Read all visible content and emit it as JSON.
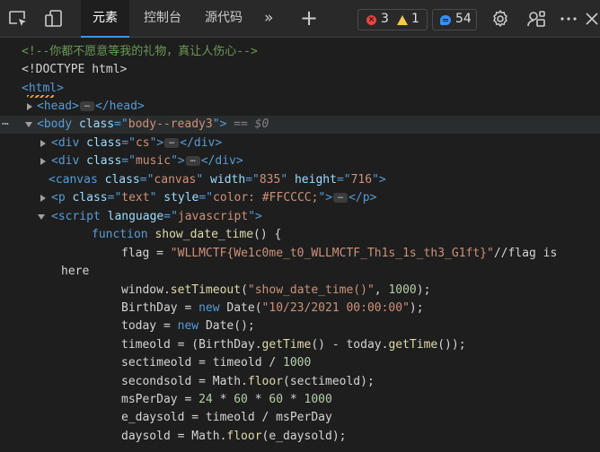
{
  "toolbar": {
    "tabs": [
      {
        "label": "元素",
        "active": true
      },
      {
        "label": "控制台",
        "active": false
      },
      {
        "label": "源代码",
        "active": false
      }
    ],
    "more_tabs": "»",
    "add_tab": "+",
    "errors": "3",
    "warnings": "1",
    "messages": "54",
    "icons": [
      "inspect-element-icon",
      "device-emulation-icon",
      "settings-gear-icon",
      "connected-devices-icon",
      "more-options-icon",
      "close-icon"
    ]
  },
  "lines": [
    {
      "segs": [
        {
          "t": "<!--你都不愿意等我的礼物，真让人伤心-->",
          "c": "comment"
        }
      ]
    },
    {
      "segs": [
        {
          "t": "<!DOCTYPE html>",
          "c": "text"
        }
      ]
    },
    {
      "segs": [
        {
          "t": "<html>",
          "c": "tag"
        }
      ]
    },
    {
      "segs": [
        {
          "t": "<head>",
          "c": "tag"
        },
        {
          "t": "…",
          "c": "ellipsis"
        },
        {
          "t": "</head>",
          "c": "tag"
        }
      ]
    },
    {
      "segs": [
        {
          "t": "<body ",
          "c": "tag"
        },
        {
          "t": "class",
          "c": "attr"
        },
        {
          "t": "=\"",
          "c": "tag"
        },
        {
          "t": "body--ready3",
          "c": "val"
        },
        {
          "t": "\">",
          "c": "tag"
        },
        {
          "t": " == $0",
          "c": "muted"
        }
      ]
    },
    {
      "segs": [
        {
          "t": "<div ",
          "c": "tag"
        },
        {
          "t": "class",
          "c": "attr"
        },
        {
          "t": "=\"",
          "c": "tag"
        },
        {
          "t": "cs",
          "c": "val"
        },
        {
          "t": "\">",
          "c": "tag"
        },
        {
          "t": "…",
          "c": "ellipsis"
        },
        {
          "t": "</div>",
          "c": "tag"
        }
      ]
    },
    {
      "segs": [
        {
          "t": "<div ",
          "c": "tag"
        },
        {
          "t": "class",
          "c": "attr"
        },
        {
          "t": "=\"",
          "c": "tag"
        },
        {
          "t": "music",
          "c": "val"
        },
        {
          "t": "\">",
          "c": "tag"
        },
        {
          "t": "…",
          "c": "ellipsis"
        },
        {
          "t": "</div>",
          "c": "tag"
        }
      ]
    },
    {
      "segs": [
        {
          "t": "<canvas ",
          "c": "tag"
        },
        {
          "t": "class",
          "c": "attr"
        },
        {
          "t": "=\"",
          "c": "tag"
        },
        {
          "t": "canvas",
          "c": "val"
        },
        {
          "t": "\" ",
          "c": "tag"
        },
        {
          "t": "width",
          "c": "attr"
        },
        {
          "t": "=\"",
          "c": "tag"
        },
        {
          "t": "835",
          "c": "val"
        },
        {
          "t": "\" ",
          "c": "tag"
        },
        {
          "t": "height",
          "c": "attr"
        },
        {
          "t": "=\"",
          "c": "tag"
        },
        {
          "t": "716",
          "c": "val"
        },
        {
          "t": "\">",
          "c": "tag"
        }
      ]
    },
    {
      "segs": [
        {
          "t": "<p ",
          "c": "tag"
        },
        {
          "t": "class",
          "c": "attr"
        },
        {
          "t": "=\"",
          "c": "tag"
        },
        {
          "t": "text",
          "c": "val"
        },
        {
          "t": "\" ",
          "c": "tag"
        },
        {
          "t": "style",
          "c": "attr"
        },
        {
          "t": "=\"",
          "c": "tag"
        },
        {
          "t": "color: #FFCCCC;",
          "c": "val"
        },
        {
          "t": "\">",
          "c": "tag"
        },
        {
          "t": "…",
          "c": "ellipsis"
        },
        {
          "t": "</p>",
          "c": "tag"
        }
      ]
    },
    {
      "segs": [
        {
          "t": "<script ",
          "c": "tag"
        },
        {
          "t": "language",
          "c": "attr"
        },
        {
          "t": "=\"",
          "c": "tag"
        },
        {
          "t": "javascript",
          "c": "val"
        },
        {
          "t": "\">",
          "c": "tag"
        }
      ]
    },
    {
      "segs": [
        {
          "t": "function ",
          "c": "kw"
        },
        {
          "t": "show_date_time",
          "c": "fnname"
        },
        {
          "t": "() {",
          "c": "plain"
        }
      ]
    },
    {
      "segs": [
        {
          "t": "flag = ",
          "c": "plain"
        },
        {
          "t": "\"WLLMCTF{We1c0me_t0_WLLMCTF_Th1s_1s_th3_G1ft}\"",
          "c": "val"
        },
        {
          "t": "//flag is",
          "c": "plain"
        }
      ]
    },
    {
      "segs": [
        {
          "t": "here",
          "c": "plain"
        }
      ]
    },
    {
      "segs": [
        {
          "t": "window.",
          "c": "plain"
        },
        {
          "t": "setTimeout",
          "c": "fn"
        },
        {
          "t": "(",
          "c": "plain"
        },
        {
          "t": "\"show_date_time()\"",
          "c": "val"
        },
        {
          "t": ", ",
          "c": "plain"
        },
        {
          "t": "1000",
          "c": "num"
        },
        {
          "t": ");",
          "c": "plain"
        }
      ]
    },
    {
      "segs": [
        {
          "t": "BirthDay = ",
          "c": "plain"
        },
        {
          "t": "new ",
          "c": "kw"
        },
        {
          "t": "Date(",
          "c": "plain"
        },
        {
          "t": "\"10/23/2021 00:00:00\"",
          "c": "val"
        },
        {
          "t": ");",
          "c": "plain"
        }
      ]
    },
    {
      "segs": [
        {
          "t": "today = ",
          "c": "plain"
        },
        {
          "t": "new ",
          "c": "kw"
        },
        {
          "t": "Date();",
          "c": "plain"
        }
      ]
    },
    {
      "segs": [
        {
          "t": "timeold = (BirthDay.",
          "c": "plain"
        },
        {
          "t": "getTime",
          "c": "fn"
        },
        {
          "t": "() - today.",
          "c": "plain"
        },
        {
          "t": "getTime",
          "c": "fn"
        },
        {
          "t": "());",
          "c": "plain"
        }
      ]
    },
    {
      "segs": [
        {
          "t": "sectimeold = timeold / ",
          "c": "plain"
        },
        {
          "t": "1000",
          "c": "num"
        }
      ]
    },
    {
      "segs": [
        {
          "t": "secondsold = Math.",
          "c": "plain"
        },
        {
          "t": "floor",
          "c": "fn"
        },
        {
          "t": "(sectimeold);",
          "c": "plain"
        }
      ]
    },
    {
      "segs": [
        {
          "t": "msPerDay = ",
          "c": "plain"
        },
        {
          "t": "24",
          "c": "num"
        },
        {
          "t": " * ",
          "c": "plain"
        },
        {
          "t": "60",
          "c": "num"
        },
        {
          "t": " * ",
          "c": "plain"
        },
        {
          "t": "60",
          "c": "num"
        },
        {
          "t": " * ",
          "c": "plain"
        },
        {
          "t": "1000",
          "c": "num"
        }
      ]
    },
    {
      "segs": [
        {
          "t": "e_daysold = timeold / msPerDay",
          "c": "plain"
        }
      ]
    },
    {
      "segs": [
        {
          "t": "daysold = Math.",
          "c": "plain"
        },
        {
          "t": "floor",
          "c": "fn"
        },
        {
          "t": "(e_daysold);",
          "c": "plain"
        }
      ]
    }
  ]
}
